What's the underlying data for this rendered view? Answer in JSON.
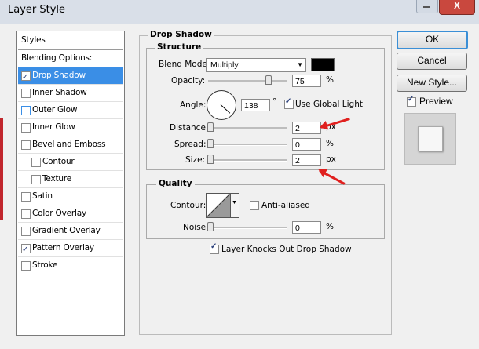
{
  "window": {
    "title": "Layer Style",
    "close_glyph": "X"
  },
  "styles": {
    "header": "Styles",
    "items": [
      {
        "label": "Blending Options: Default",
        "checkbox": false
      },
      {
        "label": "Drop Shadow",
        "checkbox": true,
        "checked": true,
        "selected": true
      },
      {
        "label": "Inner Shadow",
        "checkbox": true,
        "checked": false
      },
      {
        "label": "Outer Glow",
        "checkbox": true,
        "checked": false
      },
      {
        "label": "Inner Glow",
        "checkbox": true,
        "checked": false
      },
      {
        "label": "Bevel and Emboss",
        "checkbox": true,
        "checked": false
      },
      {
        "label": "Contour",
        "checkbox": true,
        "checked": false,
        "indent": true
      },
      {
        "label": "Texture",
        "checkbox": true,
        "checked": false,
        "indent": true
      },
      {
        "label": "Satin",
        "checkbox": true,
        "checked": false
      },
      {
        "label": "Color Overlay",
        "checkbox": true,
        "checked": false
      },
      {
        "label": "Gradient Overlay",
        "checkbox": true,
        "checked": false
      },
      {
        "label": "Pattern Overlay",
        "checkbox": true,
        "checked": true
      },
      {
        "label": "Stroke",
        "checkbox": true,
        "checked": false
      }
    ]
  },
  "drop_shadow": {
    "title": "Drop Shadow",
    "structure": {
      "title": "Structure",
      "blend_mode_label": "Blend Mode:",
      "blend_mode_value": "Multiply",
      "shadow_color": "#000000",
      "opacity_label": "Opacity:",
      "opacity_value": "75",
      "opacity_unit": "%",
      "angle_label": "Angle:",
      "angle_value": "138",
      "angle_unit": "°",
      "use_global_light_label": "Use Global Light",
      "use_global_light": true,
      "distance_label": "Distance:",
      "distance_value": "2",
      "distance_unit": "px",
      "spread_label": "Spread:",
      "spread_value": "0",
      "spread_unit": "%",
      "size_label": "Size:",
      "size_value": "2",
      "size_unit": "px"
    },
    "quality": {
      "title": "Quality",
      "contour_label": "Contour:",
      "anti_aliased_label": "Anti-aliased",
      "anti_aliased": false,
      "noise_label": "Noise:",
      "noise_value": "0",
      "noise_unit": "%"
    },
    "knockout_label": "Layer Knocks Out Drop Shadow",
    "knockout": true
  },
  "buttons": {
    "ok": "OK",
    "cancel": "Cancel",
    "new_style": "New Style..."
  },
  "preview": {
    "label": "Preview",
    "checked": true
  },
  "annotation_color": "#e0201e"
}
